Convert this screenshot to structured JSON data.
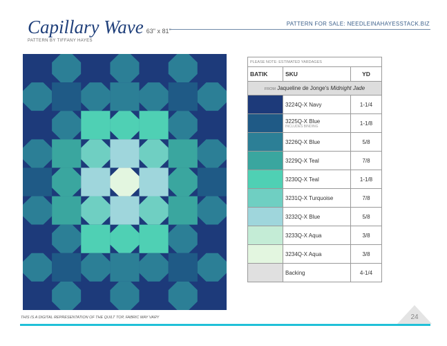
{
  "header": {
    "title": "Capillary Wave",
    "size": "63\" x 81\"",
    "sale": "PATTERN FOR SALE: NEEDLEINAHAYESSTACK.BIZ",
    "byline": "PATTERN BY TIFFANY HAYES"
  },
  "table": {
    "note": "PLEASE NOTE: ESTIMATED YARDAGES",
    "headers": [
      "BATIK",
      "SKU",
      "YD"
    ],
    "from_prefix": "FROM",
    "from_text": "Jaqueline de Jonge's",
    "from_collection": "Midnight Jade",
    "rows": [
      {
        "sku": "3224Q-X Navy",
        "yd": "1-1/4",
        "color": "#1d3a7a"
      },
      {
        "sku": "3225Q-X Blue",
        "sub": "INCLUDES BINDING",
        "yd": "1-1/8",
        "color": "#1f5a86"
      },
      {
        "sku": "3226Q-X Blue",
        "yd": "5/8",
        "color": "#2c7f96"
      },
      {
        "sku": "3229Q-X Teal",
        "yd": "7/8",
        "color": "#3aa69f"
      },
      {
        "sku": "3230Q-X Teal",
        "yd": "1-1/8",
        "color": "#4fd0b4"
      },
      {
        "sku": "3231Q-X Turquoise",
        "yd": "7/8",
        "color": "#6fcfc2"
      },
      {
        "sku": "3232Q-X Blue",
        "yd": "5/8",
        "color": "#9fd6dc"
      },
      {
        "sku": "3233Q-X Aqua",
        "yd": "3/8",
        "color": "#c4ecd6"
      },
      {
        "sku": "3234Q-X Aqua",
        "yd": "3/8",
        "color": "#e3f6e0"
      },
      {
        "sku": "Backing",
        "yd": "4-1/4",
        "color": "#e0e0e0"
      }
    ]
  },
  "footer": {
    "text": "THIS IS A DIGITAL REPRESENTATION OF THE QUILT TOP, FABRIC MAY VARY",
    "page": "24"
  }
}
